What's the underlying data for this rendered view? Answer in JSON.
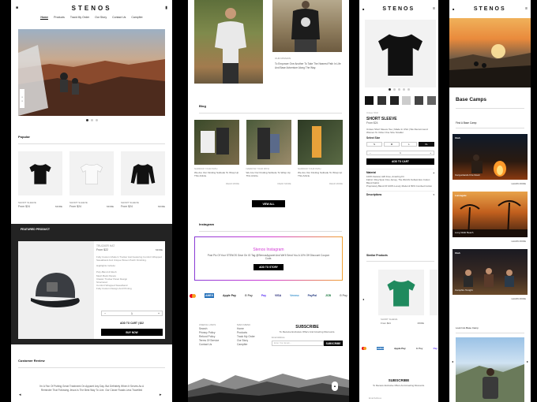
{
  "brand": "STENOS",
  "nav": [
    "Home",
    "Products",
    "Track My Order",
    "Our Story",
    "Contact Us",
    "Campfire"
  ],
  "popular": {
    "title": "Popular",
    "products": [
      {
        "name": "SHORT SLEEVE",
        "price": "From $24",
        "more": "MORE"
      },
      {
        "name": "SHORT SLEEVE",
        "price": "From $24",
        "more": "MORE"
      },
      {
        "name": "SHORT SLEEVE",
        "price": "From $24",
        "more": "MORE"
      }
    ]
  },
  "featured": {
    "band": "FEATURED PRODUCT",
    "title": "TRUCKER HAT",
    "price": "From $22",
    "more": "MORE",
    "desc": "Fully Custom Modern Trucker Hat Featuring Comfort Wrapped Sweatband And Unique Woven Patch Finishing.",
    "highlights_title": "Highlights Include:",
    "highlights": [
      "Poly-Blend & Mesh",
      "Mesh Back Panels",
      "Classic Trucker Panel Design",
      "Structured",
      "Comfort Wrapped Sweatband",
      "Fully Custom Design And Printing"
    ],
    "qty": "1",
    "add": "ADD TO CART | $22",
    "buy": "BUY NOW"
  },
  "review": {
    "title": "Customer Review",
    "text": "I'm A Fan Of Putting Great Treatment On Apparel Any Day. But Definitely When It Serves As A Reminder That Following Jesus Is The Best Way To Live. Our Closer Roads Less Travelled"
  },
  "c2": {
    "caption_small": "OUR MISSION",
    "caption": "To Empower One Another To Take The Nearest Path In Life And Base Adventure Along The Way.",
    "blog_title": "Blog",
    "blog": [
      {
        "tag": "NARROW YOUR PATH",
        "text": "We Are Our Finding Solitude To Wrap Up This Article.",
        "more": "READ MORE"
      },
      {
        "tag": "NARROW YOUR PATH",
        "text": "We Are Our Finding Solitude To Wrap Up This Article.",
        "more": "READ MORE"
      },
      {
        "tag": "NARROW YOUR PATH",
        "text": "We Are Our Finding Solitude To Wrap Up This Article.",
        "more": "READ MORE"
      }
    ],
    "view_all": "VIEW ALL",
    "instagram_title": "Instagram",
    "promo_title": "Stenos Instagram",
    "promo_text": "Post Pic Of Your STENOS Gear On IG Tag @StenosApparel And We'll Send You A 10% Off Discount Coupon Code.",
    "promo_btn": "ADD TO STORY",
    "payments": [
      "AMEX",
      "Apple Pay",
      "G Pay",
      "Pay",
      "VISA",
      "Venmo",
      "PayPal",
      "JCB",
      "G Pay"
    ],
    "footer_cols": [
      {
        "title": "USEFUL LINKS",
        "items": [
          "Search",
          "Privacy Policy",
          "Refund Policy",
          "Terms Of Service",
          "Contact Us"
        ]
      },
      {
        "title": "MAIN MENU",
        "items": [
          "Home",
          "Products",
          "Track My Order",
          "Our Story",
          "Campfire"
        ]
      }
    ],
    "subscribe_title": "SUBSCRIBE",
    "subscribe_text": "To Receive Exclusive Offers And Amazing Discounts.",
    "email_label": "Email Address",
    "email_placeholder": "Enter Your Email...",
    "subscribe_btn": "SUBSCRIBE"
  },
  "c3": {
    "breadcrumb": "Unisex Shirt",
    "title": "SHORT SLEEVE",
    "price": "From $24",
    "desc": "Unisex Short Sleeve Tee | Made In USA | We Recommend Women To Order One Size Smaller",
    "size_label": "Select Size",
    "sizes": [
      "S",
      "M",
      "L",
      "XL"
    ],
    "qty": "1",
    "add": "ADD TO CART",
    "material_title": "Material",
    "material": [
      "100% Natural, A20 Free, Amazing Fit",
      "Fabric: Ring Spun Fine Jersey, The World's Softest Eco Cotton Blend Fabric",
      "Proprietary Blend Of 100% Luxury Model & 50% Combed Cotton"
    ],
    "desc_title": "Descriptions",
    "similar": "Similar Products",
    "sim_name": "SHORT SLEEVE",
    "sim_price": "From $24",
    "sim_more": "MORE",
    "subscribe_title": "SUBSCRIBE",
    "subscribe_text": "To Receive Exclusive Offers And Amazing Discounts.",
    "email_label": "Email Address"
  },
  "c4": {
    "title": "Base Camps",
    "subtitle": "Find A Base Camp",
    "cards": [
      {
        "place": "Utah",
        "caption": "Canyonlands Fire Down",
        "more": "LEARN MORE"
      },
      {
        "place": "Lanzagate",
        "caption": "Long Walk Beach",
        "more": "LEARN MORE"
      },
      {
        "place": "Utah",
        "caption": "Campfire Tonight",
        "more": "LEARN MORE"
      }
    ],
    "look_title": "Look Into Base Camp"
  },
  "colors": {
    "accent": "#000000",
    "featured_band": "#222222",
    "promo_grad": "#d23bd6"
  }
}
